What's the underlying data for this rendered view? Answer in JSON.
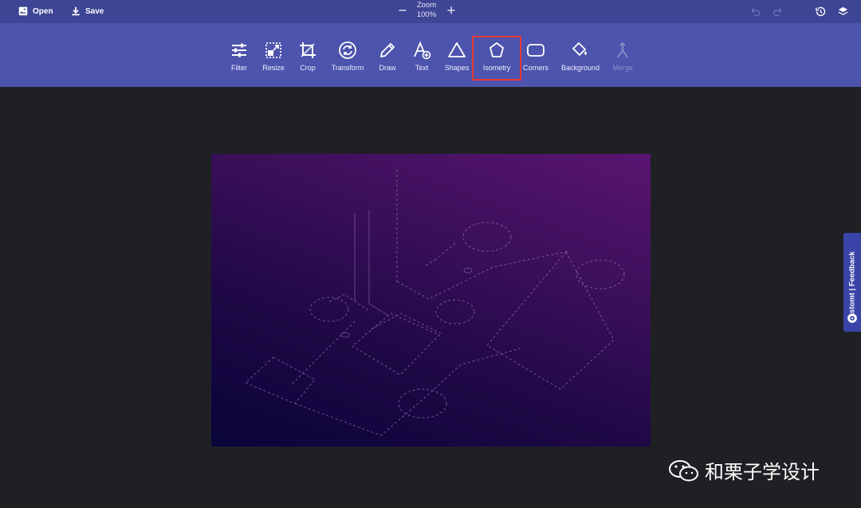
{
  "topbar": {
    "open_label": "Open",
    "save_label": "Save",
    "zoom_label": "Zoom",
    "zoom_value": "100%",
    "icons": [
      "image-icon",
      "download-icon",
      "minus-icon",
      "plus-icon",
      "undo-icon",
      "redo-icon",
      "history-icon",
      "layers-icon"
    ]
  },
  "toolbar": {
    "items": [
      {
        "label": "Filter",
        "icon": "sliders-icon"
      },
      {
        "label": "Resize",
        "icon": "resize-icon"
      },
      {
        "label": "Crop",
        "icon": "crop-icon"
      },
      {
        "label": "Transform",
        "icon": "rotate-icon"
      },
      {
        "label": "Draw",
        "icon": "pencil-icon"
      },
      {
        "label": "Text",
        "icon": "text-icon"
      },
      {
        "label": "Shapes",
        "icon": "triangle-icon"
      },
      {
        "label": "Isometry",
        "icon": "pentagon-icon",
        "highlighted": true
      },
      {
        "label": "Corners",
        "icon": "rounded-rect-icon"
      },
      {
        "label": "Background",
        "icon": "paint-bucket-icon"
      },
      {
        "label": "Merge",
        "icon": "merge-icon",
        "disabled": true
      }
    ]
  },
  "feedback": {
    "label": "stomt | Feedback",
    "icon": "stomt-icon"
  },
  "watermark": {
    "text": "和栗子学设计",
    "icon": "wechat-icon"
  },
  "colors": {
    "topbar": "#3f4595",
    "toolbar": "#4d54ad",
    "canvas_bg": "#1f2024",
    "highlight": "#e53935",
    "feedback": "#3a44a8"
  }
}
